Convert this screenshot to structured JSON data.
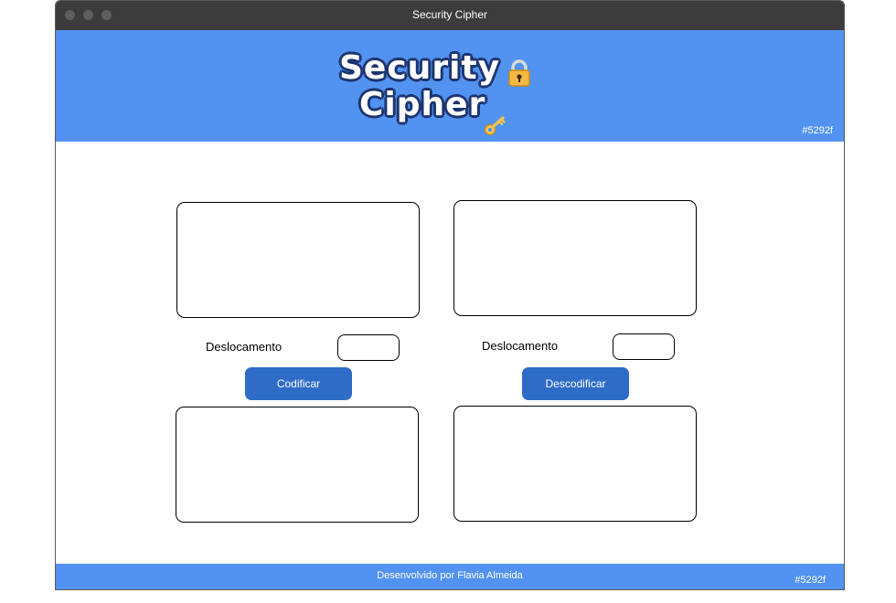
{
  "window": {
    "title": "Security Cipher"
  },
  "header": {
    "logo_line1": "Security",
    "logo_line2": "Cipher",
    "color_tag": "#5292f"
  },
  "encode_panel": {
    "input_value": "",
    "shift_label": "Deslocamento",
    "shift_value": "",
    "button_label": "Codificar",
    "output_value": ""
  },
  "decode_panel": {
    "input_value": "",
    "shift_label": "Deslocamento",
    "shift_value": "",
    "button_label": "Descodificar",
    "output_value": ""
  },
  "footer": {
    "text": "Desenvolvido por Flavia Almeida",
    "color_tag": "#5292f"
  },
  "colors": {
    "header_bg": "#5292f0",
    "button_bg": "#2f6cc7",
    "titlebar_bg": "#3c3c3c"
  },
  "icons": [
    "lock-icon",
    "key-icon"
  ]
}
